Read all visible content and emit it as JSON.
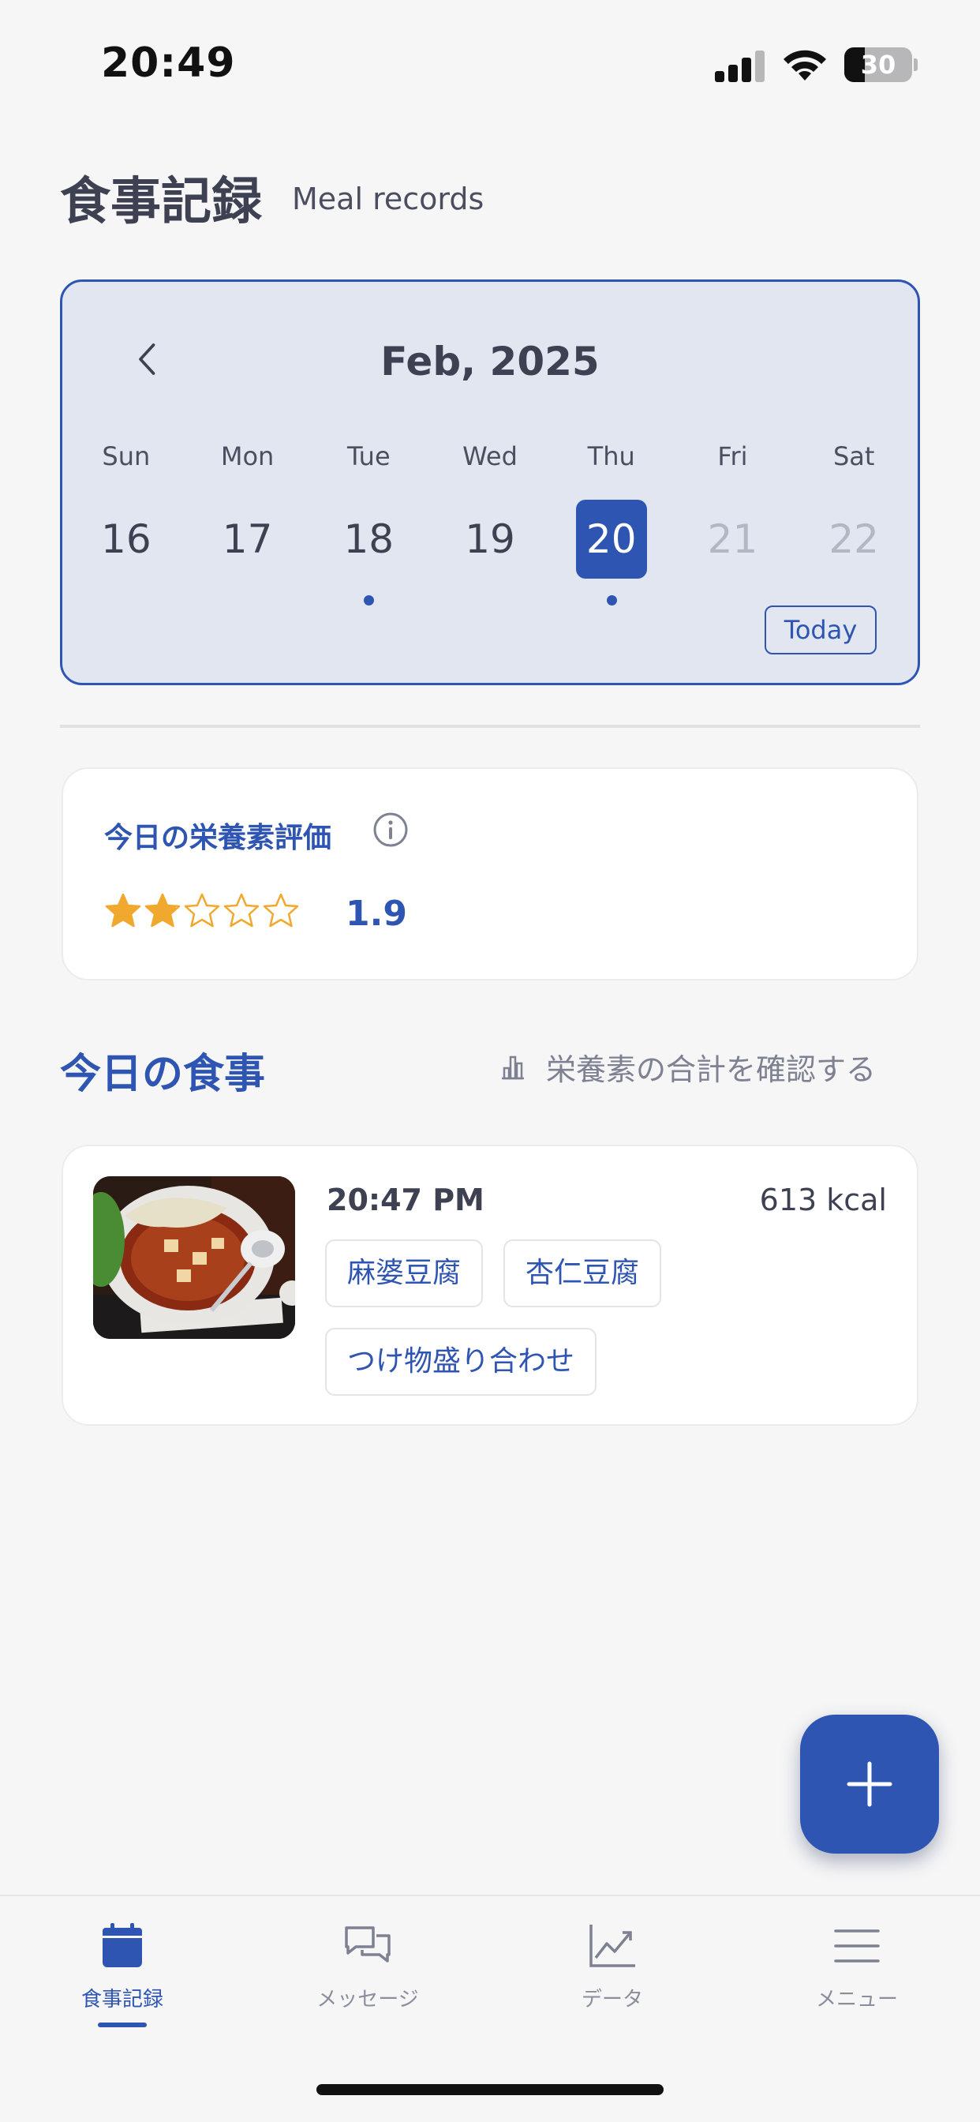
{
  "status_bar": {
    "time": "20:49",
    "battery": "30",
    "battery_level": 0.3
  },
  "header": {
    "title": "食事記録",
    "subtitle": "Meal records"
  },
  "calendar": {
    "month_label": "Feb, 2025",
    "weekdays": [
      "Sun",
      "Mon",
      "Tue",
      "Wed",
      "Thu",
      "Fri",
      "Sat"
    ],
    "days": [
      {
        "num": "16",
        "state": "past",
        "has_record": false
      },
      {
        "num": "17",
        "state": "past",
        "has_record": false
      },
      {
        "num": "18",
        "state": "past",
        "has_record": true
      },
      {
        "num": "19",
        "state": "past",
        "has_record": false
      },
      {
        "num": "20",
        "state": "selected",
        "has_record": true
      },
      {
        "num": "21",
        "state": "future",
        "has_record": false
      },
      {
        "num": "22",
        "state": "future",
        "has_record": false
      }
    ],
    "today_label": "Today"
  },
  "nutrition": {
    "title": "今日の栄養素評価",
    "score": "1.9",
    "rating": 1.9,
    "max_rating": 5,
    "info_icon": "info-circle-icon"
  },
  "meals": {
    "title": "今日の食事",
    "total_link": "栄養素の合計を確認する",
    "items": [
      {
        "time": "20:47 PM",
        "kcal": "613 kcal",
        "tags": [
          "麻婆豆腐",
          "杏仁豆腐",
          "つけ物盛り合わせ"
        ]
      }
    ]
  },
  "tabs": [
    {
      "label": "食事記録",
      "icon": "calendar-icon",
      "active": true
    },
    {
      "label": "メッセージ",
      "icon": "chat-icon",
      "active": false
    },
    {
      "label": "データ",
      "icon": "chart-line-icon",
      "active": false
    },
    {
      "label": "メニュー",
      "icon": "menu-icon",
      "active": false
    }
  ],
  "colors": {
    "accent": "#2f55b3",
    "star": "#f0a92e",
    "background": "#f6f6f7",
    "calendar_bg": "#e2e6f0"
  }
}
